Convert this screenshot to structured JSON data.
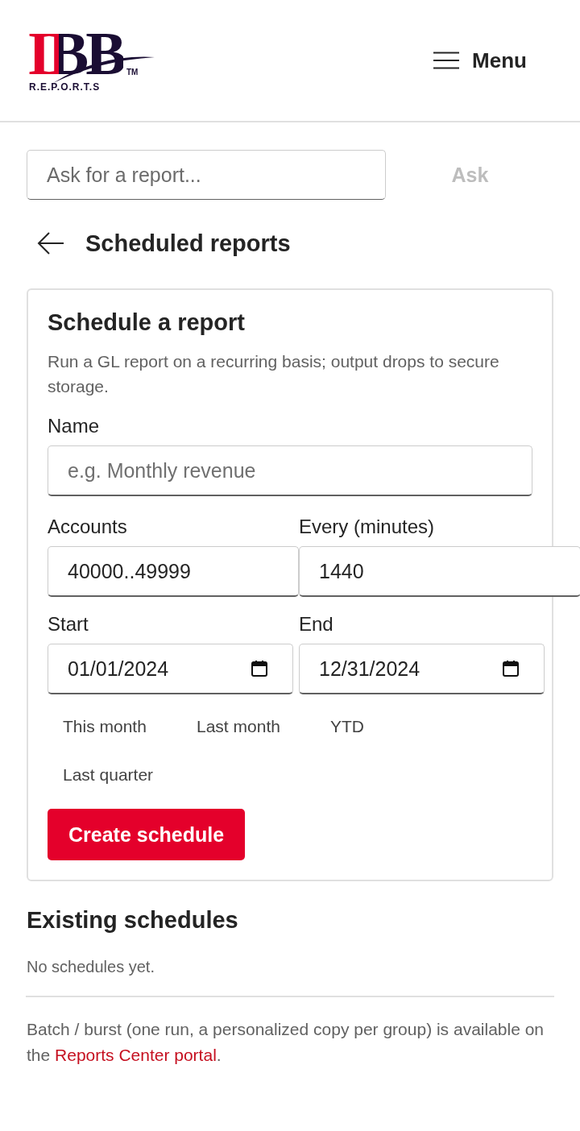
{
  "header": {
    "logo": {
      "wordmark": "IBB",
      "trademark": "TM",
      "tagline": "R.E.P.O.R.T.S"
    },
    "menu_button": {
      "label": "Menu"
    }
  },
  "ask": {
    "placeholder": "Ask for a report...",
    "button": "Ask",
    "button_disabled": true
  },
  "page_title": "Scheduled reports",
  "form": {
    "title": "Schedule a report",
    "description": "Run a GL report on a recurring basis; output drops to secure storage.",
    "fields": [
      {
        "kind": "text",
        "label": "Name",
        "placeholder": "e.g. Monthly revenue"
      },
      {
        "kind": "text",
        "label": "Accounts",
        "value": "40000..49999"
      },
      {
        "kind": "text",
        "label": "Every (minutes)",
        "value": "1440"
      },
      {
        "kind": "date",
        "label": "Start",
        "value": "01/01/2024"
      },
      {
        "kind": "date",
        "label": "End",
        "value": "12/31/2024"
      }
    ],
    "quick_ranges": [
      "This month",
      "Last month",
      "YTD",
      "Last quarter"
    ],
    "submit": "Create schedule"
  },
  "existing": {
    "title": "Existing schedules",
    "empty_text": "No schedules yet."
  },
  "footer": {
    "text": "Batch / burst (one run, a personalized copy per group) is available on the ",
    "link": "Reports Center portal",
    "after": "."
  }
}
